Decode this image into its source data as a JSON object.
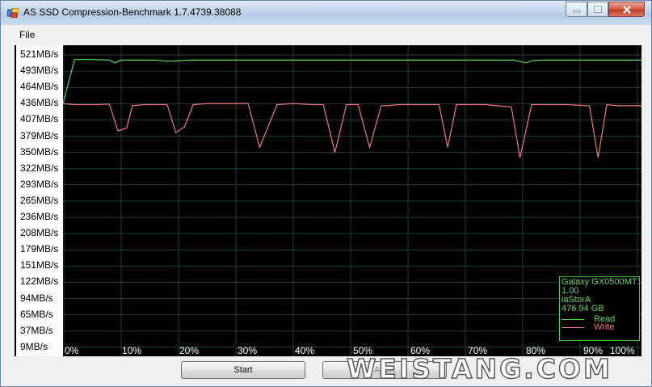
{
  "window": {
    "title": "AS SSD Compression-Benchmark 1.7.4739.38088"
  },
  "menu": {
    "items": [
      "File"
    ]
  },
  "buttons": {
    "start": "Start",
    "abort": "Abort"
  },
  "watermark": "WEISTANG.COM",
  "legend": {
    "device_lines": [
      "Galaxy GX0500MT1",
      "1.00",
      "iaStorA",
      "476.94 GB"
    ],
    "read_label": "Read",
    "write_label": "Write",
    "read_color": "#5fd35f",
    "write_color": "#ee7a7a"
  },
  "chart_data": {
    "type": "line",
    "title": "",
    "xlabel": "",
    "ylabel": "",
    "y_ticks": [
      "521MB/s",
      "493MB/s",
      "464MB/s",
      "436MB/s",
      "407MB/s",
      "379MB/s",
      "350MB/s",
      "322MB/s",
      "293MB/s",
      "265MB/s",
      "236MB/s",
      "208MB/s",
      "179MB/s",
      "151MB/s",
      "122MB/s",
      "94MB/s",
      "65MB/s",
      "37MB/s",
      "9MB/s"
    ],
    "x_ticks": [
      "0%",
      "10%",
      "20%",
      "30%",
      "40%",
      "50%",
      "60%",
      "70%",
      "80%",
      "90%",
      "100%"
    ],
    "ylim": [
      9,
      521
    ],
    "xlim": [
      0,
      100
    ],
    "grid": true,
    "legend_position": "bottom-right",
    "series": [
      {
        "name": "Read",
        "x": [
          0,
          2,
          5,
          8,
          9,
          10,
          14,
          16,
          18,
          22,
          25,
          30,
          40,
          50,
          60,
          70,
          78,
          80,
          81,
          83,
          90,
          100
        ],
        "y": [
          436,
          513,
          513,
          512,
          507,
          512,
          512,
          512,
          510,
          512,
          512,
          512,
          512,
          512,
          512,
          512,
          512,
          507,
          511,
          512,
          512,
          512
        ]
      },
      {
        "name": "Write",
        "x": [
          0,
          2,
          4,
          6,
          8,
          9.5,
          11,
          12,
          14,
          18,
          19.5,
          21,
          22.5,
          25,
          30,
          32,
          34,
          37,
          40,
          43,
          45,
          47,
          49,
          51,
          53,
          55,
          56,
          58,
          62,
          65,
          66.5,
          68,
          70,
          73,
          75,
          77.5,
          79,
          81,
          84,
          87,
          91,
          92.5,
          94,
          96,
          100
        ],
        "y": [
          436,
          434,
          434,
          434,
          435,
          388,
          393,
          432,
          434,
          434,
          385,
          395,
          434,
          436,
          436,
          436,
          359,
          434,
          436,
          434,
          434,
          350,
          434,
          434,
          359,
          432,
          432,
          434,
          434,
          434,
          359,
          434,
          434,
          434,
          432,
          430,
          341,
          434,
          434,
          434,
          432,
          341,
          434,
          432,
          432
        ]
      }
    ]
  }
}
